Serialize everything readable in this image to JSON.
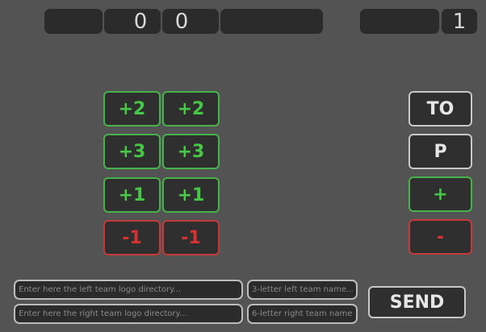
{
  "scoreboard": {
    "left_score": "0",
    "right_score": "0",
    "period": "1"
  },
  "left_buttons": [
    "+2",
    "+3",
    "+1",
    "-1"
  ],
  "right_buttons": [
    "+2",
    "+3",
    "+1",
    "-1"
  ],
  "side_buttons": {
    "timeout": "TO",
    "period": "P",
    "plus": "+",
    "minus": "-"
  },
  "inputs": {
    "left_logo_placeholder": "Enter here the left team logo directory...",
    "left_name_placeholder": "3-letter left team name...",
    "right_logo_placeholder": "Enter here the right team logo directory...",
    "right_name_placeholder": "6-letter right team name..."
  },
  "send_label": "SEND",
  "colors": {
    "green": "#46c846",
    "red": "#d63232",
    "bg": "#535353"
  }
}
